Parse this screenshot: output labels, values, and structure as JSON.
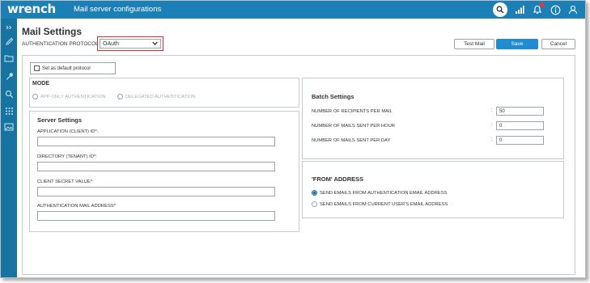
{
  "app": {
    "logo": "wrench",
    "page_heading": "Mail server configurations"
  },
  "topbar": {
    "icons": [
      "search-icon",
      "signal-icon",
      "bell-icon",
      "info-icon",
      "user-icon"
    ]
  },
  "rail": {
    "icons": [
      "expand-icon",
      "pencil-icon",
      "folder-icon",
      "wrench-icon",
      "search-icon",
      "grid-icon",
      "image-icon"
    ]
  },
  "header": {
    "title": "Mail Settings",
    "protocol_label": "AUTHENTICATION PROTOCOL",
    "protocol_value": "OAuth",
    "test_mail_label": "Test Mail",
    "save_label": "Save",
    "cancel_label": "Cancel"
  },
  "default_protocol": {
    "label": "Set as default protocol",
    "checked": false
  },
  "mode": {
    "title": "MODE",
    "options": [
      {
        "label": "APP-ONLY AUTHENTICATION",
        "selected": false
      },
      {
        "label": "DELEGATED AUTHENTICATION",
        "selected": false
      }
    ]
  },
  "server_settings": {
    "title": "Server Settings",
    "fields": [
      {
        "label": "APPLICATION (CLIENT) ID*:",
        "value": ""
      },
      {
        "label": "DIRECTORY (TENANT) ID*:",
        "value": ""
      },
      {
        "label": "CLIENT SECRET VALUE*:",
        "value": ""
      },
      {
        "label": "AUTHENTICATION MAIL ADDRESS*",
        "value": ""
      }
    ]
  },
  "batch_settings": {
    "title": "Batch Settings",
    "rows": [
      {
        "label": "NUMBER OF RECIPIENTS PER MAIL",
        "colon": ":",
        "value": "50"
      },
      {
        "label": "NUMBER OF MAILS SENT PER HOUR",
        "colon": ":",
        "value": "0"
      },
      {
        "label": "NUMBER OF MAILS SENT PER DAY",
        "colon": ":",
        "value": "0"
      }
    ]
  },
  "from_address": {
    "title": "'FROM' ADDRESS",
    "options": [
      {
        "label": "SEND EMAILS FROM AUTHENTICATION EMAIL ADDRESS",
        "selected": true
      },
      {
        "label": "SEND EMAILS FROM CURRENT USER'S EMAIL ADDRESS",
        "selected": false
      }
    ]
  },
  "colors": {
    "topbar": "#1c7fb6",
    "rail": "#17739f",
    "primary": "#1f8dd0",
    "highlight": "#d2322d"
  }
}
